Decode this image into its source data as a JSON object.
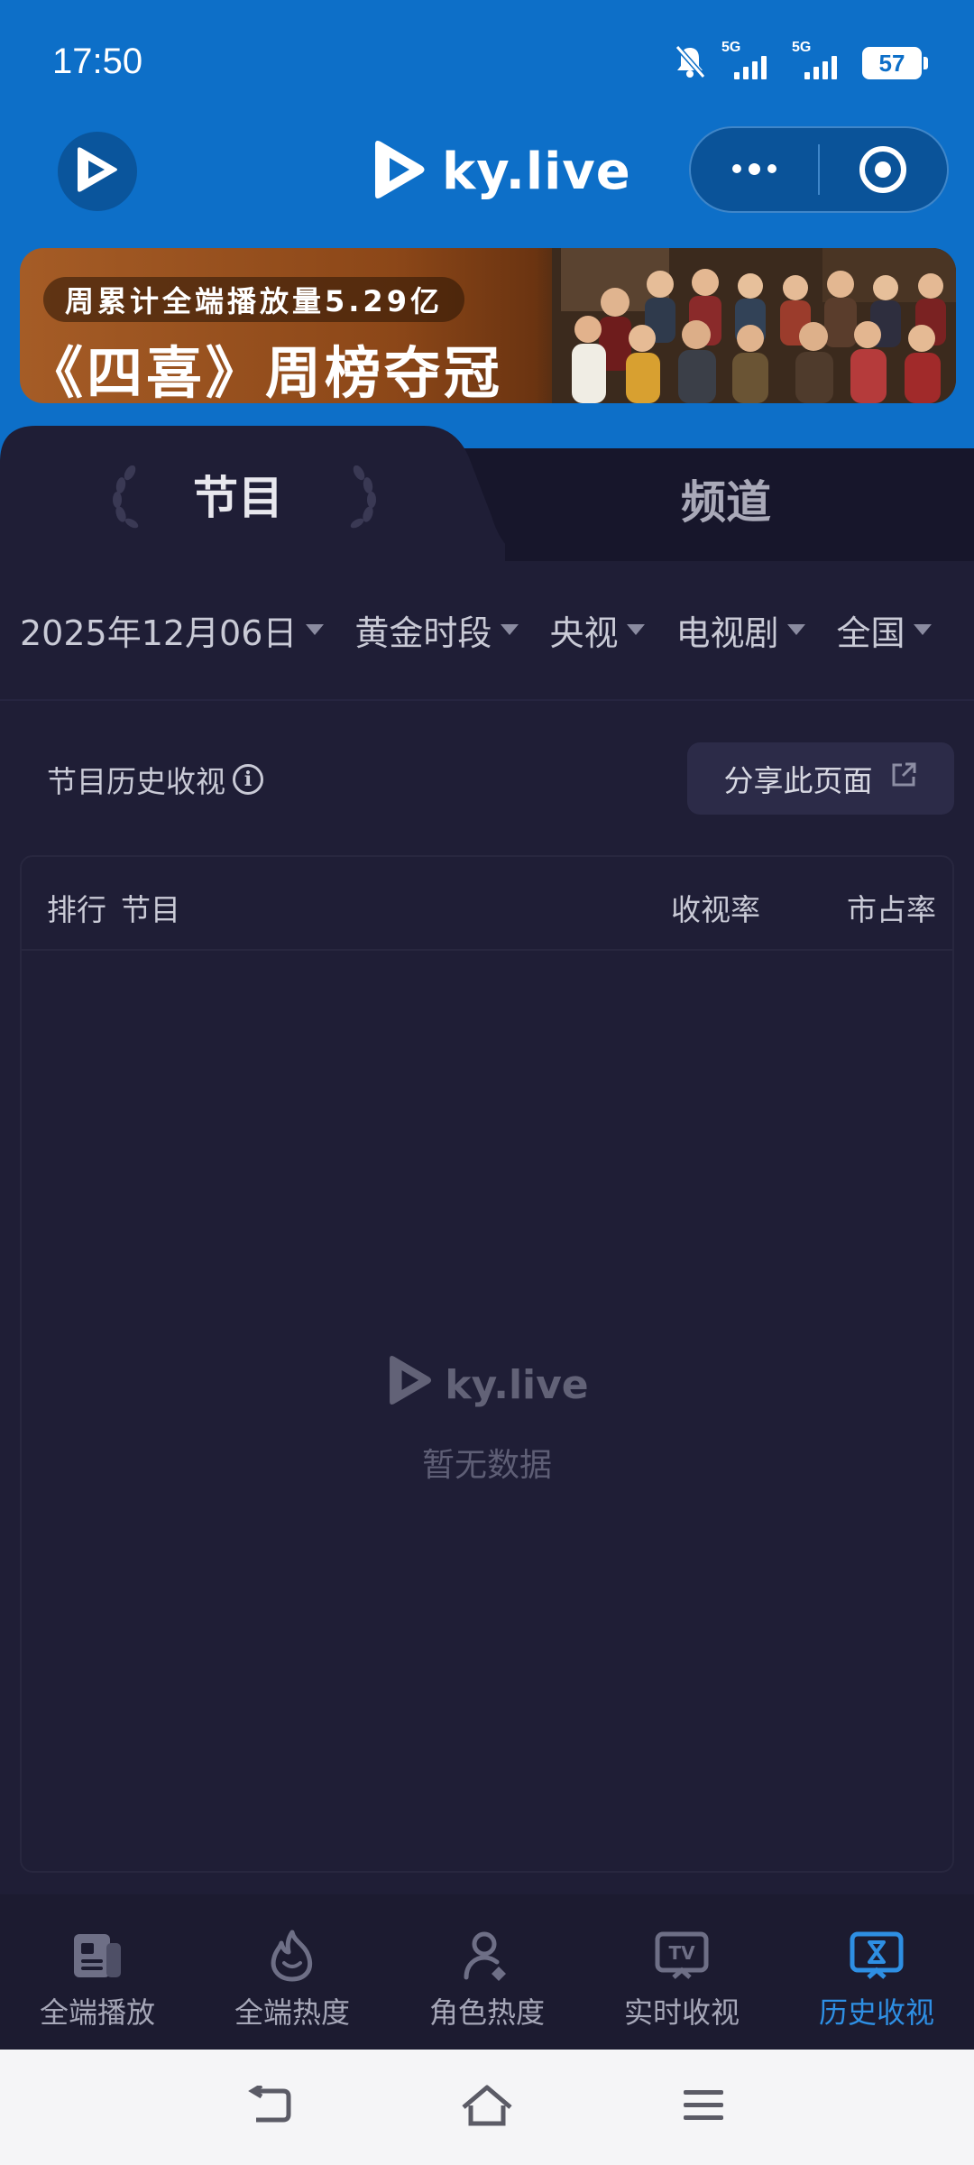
{
  "status_bar": {
    "time": "17:50",
    "network_1": "5G",
    "network_2": "5G",
    "battery": "57",
    "icons": [
      "bell-muted-icon",
      "signal-icon",
      "battery-icon"
    ]
  },
  "header": {
    "brand": "ky.live",
    "icons": [
      "play-logo-icon",
      "more-dots-icon",
      "target-icon"
    ]
  },
  "banner": {
    "line1": "周累计全端播放量5.29亿",
    "line2": "《四喜》周榜夺冠"
  },
  "tabs": [
    {
      "label": "节目",
      "active": true
    },
    {
      "label": "频道",
      "active": false
    }
  ],
  "filters": [
    {
      "label": "2025年12月06日"
    },
    {
      "label": "黄金时段"
    },
    {
      "label": "央视"
    },
    {
      "label": "电视剧"
    },
    {
      "label": "全国"
    }
  ],
  "section": {
    "title": "节目历史收视",
    "share_label": "分享此页面"
  },
  "table": {
    "columns": [
      "排行",
      "节目",
      "收视率",
      "市占率"
    ],
    "rows": [],
    "empty_brand": "ky.live",
    "empty_text": "暂无数据"
  },
  "bottom_nav": [
    {
      "label": "全端播放",
      "icon": "news-icon",
      "active": false
    },
    {
      "label": "全端热度",
      "icon": "flame-icon",
      "active": false
    },
    {
      "label": "角色热度",
      "icon": "person-icon",
      "active": false
    },
    {
      "label": "实时收视",
      "icon": "tv-icon",
      "active": false
    },
    {
      "label": "历史收视",
      "icon": "hourglass-icon",
      "active": true
    }
  ],
  "system_nav": [
    "back-icon",
    "home-icon",
    "menu-icon"
  ],
  "colors": {
    "header_blue": "#0d6fc8",
    "background": "#1f1e36",
    "accent": "#2e8fe3"
  }
}
